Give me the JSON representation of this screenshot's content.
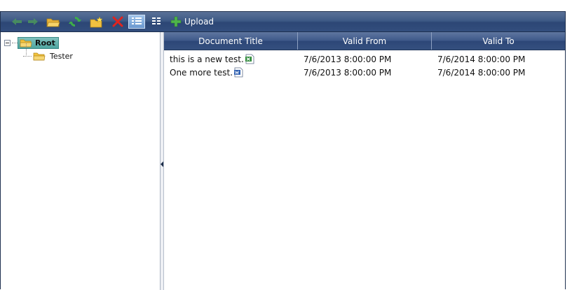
{
  "toolbar": {
    "items": [
      {
        "name": "back-arrow-icon"
      },
      {
        "name": "forward-arrow-icon"
      },
      {
        "name": "open-folder-icon"
      },
      {
        "name": "refresh-icon"
      },
      {
        "name": "new-folder-icon"
      },
      {
        "name": "delete-icon"
      },
      {
        "name": "details-view-icon"
      },
      {
        "name": "thumbnails-view-icon"
      }
    ],
    "upload_label": "Upload"
  },
  "tree": {
    "root_label": "Root",
    "children": [
      {
        "label": "Tester"
      }
    ]
  },
  "grid": {
    "columns": [
      "Document Title",
      "Valid From",
      "Valid To"
    ],
    "rows": [
      {
        "title": "this is a new test.",
        "file_icon": "excel-file-icon",
        "valid_from": "7/6/2013 8:00:00 PM",
        "valid_to": "7/6/2014 8:00:00 PM"
      },
      {
        "title": "One more test.",
        "file_icon": "word-file-icon",
        "valid_from": "7/6/2013 8:00:00 PM",
        "valid_to": "7/6/2014 8:00:00 PM"
      }
    ]
  },
  "colors": {
    "toolbar_bg": "#334e7d",
    "header_bg": "#3d5888",
    "selection": "#5fb0aa",
    "folder": "#f2c23c"
  }
}
